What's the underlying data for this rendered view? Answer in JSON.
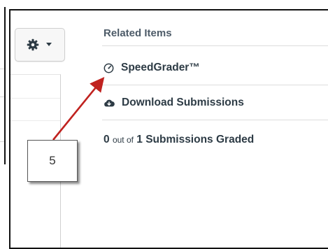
{
  "toolbar": {
    "settings_icon": "gear-icon",
    "dropdown_icon": "chevron-down-icon"
  },
  "related_items": {
    "title": "Related Items",
    "links": [
      {
        "label": "SpeedGrader™",
        "icon": "speedometer-icon"
      },
      {
        "label": "Download Submissions",
        "icon": "cloud-download-icon"
      }
    ],
    "graded": {
      "count": "0",
      "out_of_text": "out of",
      "total_text": "1 Submissions Graded"
    }
  },
  "callout": {
    "number": "5"
  },
  "colors": {
    "arrow": "#c0221f",
    "frame_border": "#111111",
    "heading_text": "#4d5b68",
    "link_text": "#2d3b45"
  }
}
